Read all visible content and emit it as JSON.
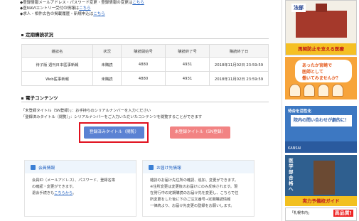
{
  "top_links": [
    {
      "prefix": "◆登録情報",
      "text": "メールアドレス・パスワード変更・登録情報の変更は",
      "link": "こちら"
    },
    {
      "prefix": "◆",
      "text": "医NAVIエントリー受付の情報は",
      "link": "こちら"
    },
    {
      "prefix": "◆",
      "text": "求人・相件広告の掲載履歴・新規申込は",
      "link": "こちら"
    }
  ],
  "subscription": {
    "title": "定期購読状況",
    "headers": [
      "雑誌名",
      "状況",
      "購読開始号",
      "購読終了号",
      "購読終了日"
    ],
    "rows": [
      [
        "待子版 週刊日本医事新報",
        "未購読",
        "4880",
        "4931",
        "2018年11月02日 23:59:59"
      ],
      [
        "Web医事新報",
        "未購読",
        "4880",
        "4931",
        "2018年11月02日 23:59:59"
      ]
    ]
  },
  "e_contents": {
    "title": "電子コンテンツ",
    "line1": "「未登録タイトル（SN登録）」：お手持ちのシリアルナンバーを入力ください",
    "line2": "「登録済みタイトル（閲覧）」：シリアルナンバーをご入力いただいたコンテンツを閲覧することができます",
    "btn_registered": "登録済みタイトル（閲覧）",
    "btn_unregistered": "未登録タイトル（SN登録）"
  },
  "member_info": {
    "title": "会員情報",
    "body1": "会員ID（メールアドレス）、パスワード、登録名簿",
    "body2": "の確認・変更ができます。",
    "body3_prefix": "退会手続きも",
    "body3_link": "こちらから",
    "body3_suffix": "。"
  },
  "delivery_info": {
    "title": "お届け先情報",
    "body1": "雑誌のお届け先住所の確認、追加、変更ができます。",
    "body2": "※住所変更は変更後のお届けにのみ反映されます。現",
    "body3": "在発行中の定期購読のお届け先を変更し、こちらで住",
    "body4": "所変更をした後に下のご注文番号→定期購読情報",
    "body5": "一律統より、お届け先変更の登録をお願いします。"
  },
  "sidebar": {
    "ad1_logo": "法部",
    "ad1_band": "再契防止を支える医療",
    "ad2_text1": "あったか宮崎で",
    "ad2_text2": "医師として",
    "ad2_text3": "働いてみませんか？",
    "ad3_head": "待合を活性化",
    "ad3_box": "院内の問い合わせが劇的に！",
    "ad3_brand": "KANSAI",
    "ad4_vertical": "医学部合格へ",
    "ad4_band": "実力予備校ガイド",
    "ad5_left": "「札幌市内」",
    "ad5_right": "高品質!"
  }
}
